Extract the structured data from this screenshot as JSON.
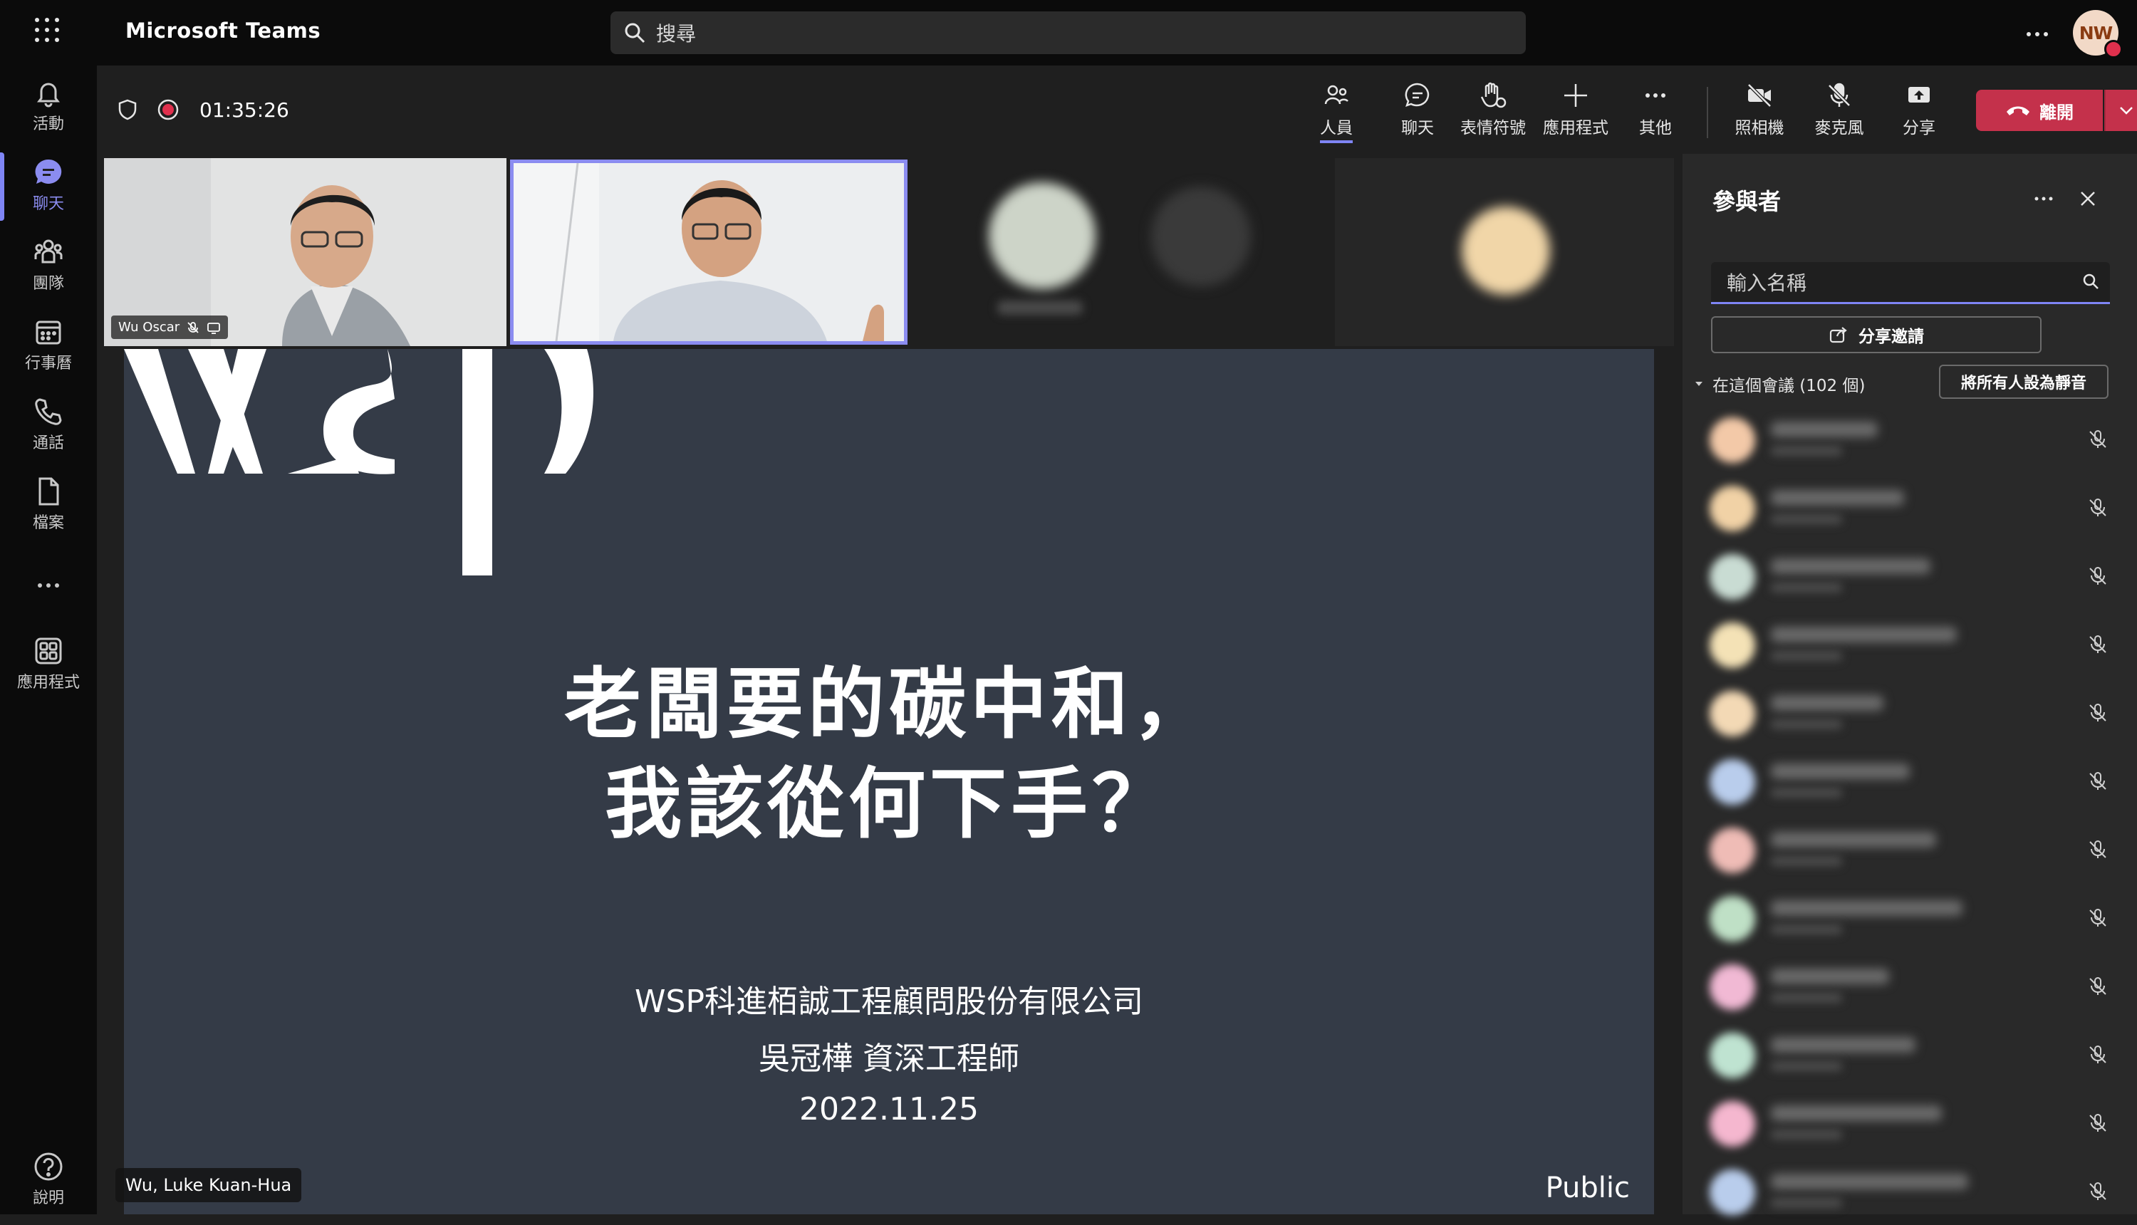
{
  "app": {
    "title": "Microsoft Teams"
  },
  "search": {
    "placeholder": "搜尋"
  },
  "user": {
    "initials": "NW",
    "status_color": "#e0304d"
  },
  "rail": {
    "items": [
      {
        "label": "活動",
        "icon": "bell-icon"
      },
      {
        "label": "聊天",
        "icon": "chat-icon",
        "active": true
      },
      {
        "label": "團隊",
        "icon": "teams-icon"
      },
      {
        "label": "行事曆",
        "icon": "calendar-icon"
      },
      {
        "label": "通話",
        "icon": "phone-icon"
      },
      {
        "label": "檔案",
        "icon": "file-icon"
      },
      {
        "label": "應用程式",
        "icon": "apps-icon"
      }
    ],
    "more": "...",
    "help": "說明"
  },
  "meeting": {
    "timer": "01:35:26",
    "toolbar": {
      "people": "人員",
      "chat": "聊天",
      "reactions": "表情符號",
      "apps": "應用程式",
      "more": "其他",
      "camera": "照相機",
      "mic": "麥克風",
      "share": "分享",
      "leave": "離開"
    },
    "accent": "#7f85f5",
    "leave_color": "#c4314b"
  },
  "videos": {
    "tile1_name": "Wu Oscar"
  },
  "slide": {
    "title_line1": "老闆要的碳中和，",
    "title_line2": "我該從何下手？",
    "company": "WSP科進栢誠工程顧問股份有限公司",
    "presenter": "吳冠樺 資深工程師",
    "date": "2022.11.25",
    "classification": "Public",
    "background": "#343b47"
  },
  "presenter_tag": "Wu, Luke Kuan-Hua",
  "panel": {
    "title": "參與者",
    "search_placeholder": "輸入名稱",
    "share_invite": "分享邀請",
    "in_meeting": "在這個會議 (102 個)",
    "mute_all": "將所有人設為靜音",
    "participant_colors": [
      "#f3c9a8",
      "#f1d2a6",
      "#c9dcd3",
      "#f4e2b6",
      "#f3d9b5",
      "#b9cdec",
      "#efbcb6",
      "#bfe0c6",
      "#f1b9d4",
      "#bfe3d1",
      "#f5b7cf",
      "#b9cdec"
    ]
  }
}
